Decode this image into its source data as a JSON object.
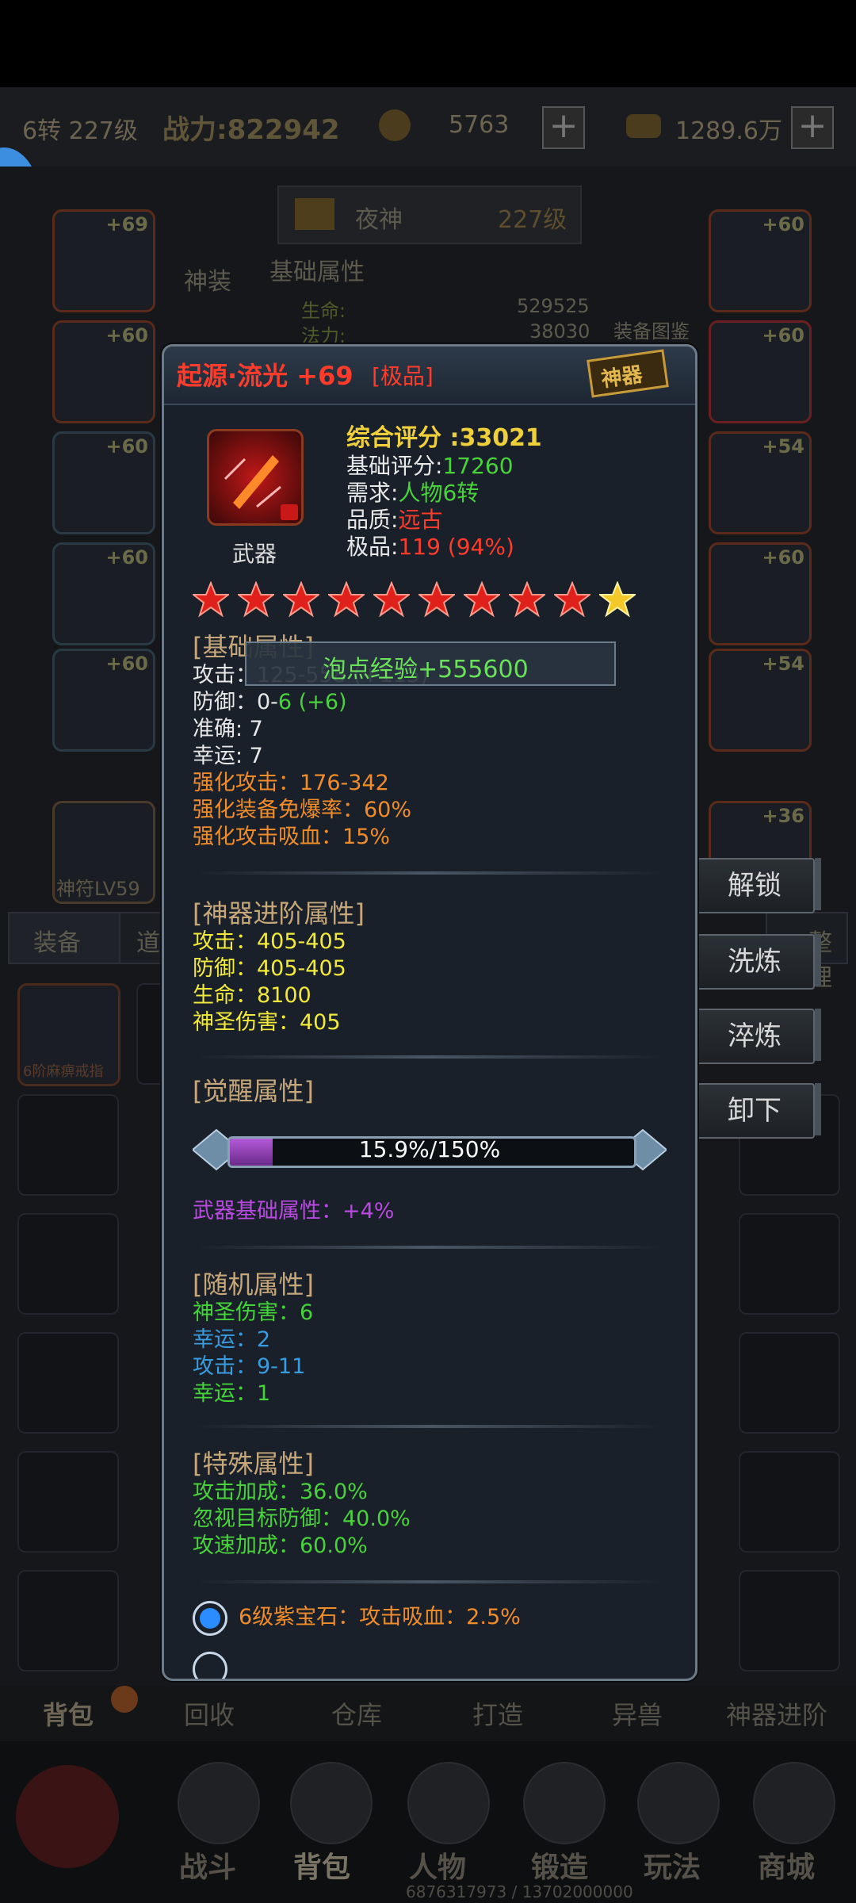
{
  "header": {
    "turn_level": "6转 227级",
    "power": "战力:822942",
    "currency1": "5763",
    "currency2": "1289.6万"
  },
  "background": {
    "character_name": "夜神",
    "character_level": "227级",
    "shenzhuang": "神装",
    "basic_attr": "基础属性",
    "hp_label": "生命:",
    "hp_value": "529525",
    "mp_label": "法力:",
    "mp_value": "38030",
    "equip_map": "装备图鉴",
    "slot_levels_left": [
      "+69",
      "+60",
      "+60",
      "+60",
      "+60"
    ],
    "slot_levels_right": [
      "+60",
      "+60",
      "+54",
      "+60",
      "+54",
      "+36"
    ],
    "shenfu": "神符LV59",
    "tab_equip": "装备",
    "tab_dao": "道",
    "tab_zheng": "整理",
    "bag_item": "6阶麻痹戒指",
    "bottom_tabs": [
      "背包",
      "回收",
      "仓库",
      "打造",
      "异兽",
      "神器进阶"
    ],
    "nav_items": [
      "战斗",
      "背包",
      "人物",
      "锻造",
      "玩法",
      "商城"
    ],
    "exp_text": "6876317973 / 13702000000"
  },
  "side_buttons": [
    "解锁",
    "洗炼",
    "淬炼",
    "卸下"
  ],
  "item": {
    "name": "起源·流光 +69",
    "grade_tag": "[极品]",
    "stamp": "神器",
    "type": "武器",
    "score_label": "综合评分 :33021",
    "base_score_label": "基础评分:",
    "base_score": "17260",
    "req_label": "需求:",
    "req": "人物6转",
    "quality_label": "品质:",
    "quality": "远古",
    "jipin_label": "极品:",
    "jipin": "119 (94%)",
    "stars_red": 9,
    "stars_gold": 1
  },
  "toast": "泡点经验+555600",
  "basic": {
    "title": "[基础属性]",
    "attack": "攻击：125-558 (+115)",
    "defense_label": "防御：0-",
    "defense_value": "6 (+6)",
    "accuracy": "准确: 7",
    "luck": "幸运: 7",
    "strengthen": [
      "强化攻击：176-342",
      "强化装备免爆率：60%",
      "强化攻击吸血：15%"
    ]
  },
  "artifact": {
    "title": "[神器进阶属性]",
    "lines": [
      "攻击：405-405",
      "防御：405-405",
      "生命：8100",
      "神圣伤害：405"
    ]
  },
  "awaken": {
    "title": "[觉醒属性]",
    "progress_text": "15.9%/150%",
    "progress_fraction": 0.106,
    "bonus": "武器基础属性：+4%"
  },
  "random": {
    "title": "[随机属性]",
    "lines": [
      {
        "text": "神圣伤害：6",
        "color": "#45d33a"
      },
      {
        "text": "幸运：2",
        "color": "#3a9ce0"
      },
      {
        "text": "攻击：9-11",
        "color": "#3a9ce0"
      },
      {
        "text": "幸运：1",
        "color": "#45d33a"
      }
    ]
  },
  "special": {
    "title": "[特殊属性]",
    "lines": [
      "攻击加成：36.0%",
      "忽视目标防御：40.0%",
      "攻速加成：60.0%"
    ]
  },
  "gem": {
    "text": "6级紫宝石：攻击吸血：2.5%"
  }
}
